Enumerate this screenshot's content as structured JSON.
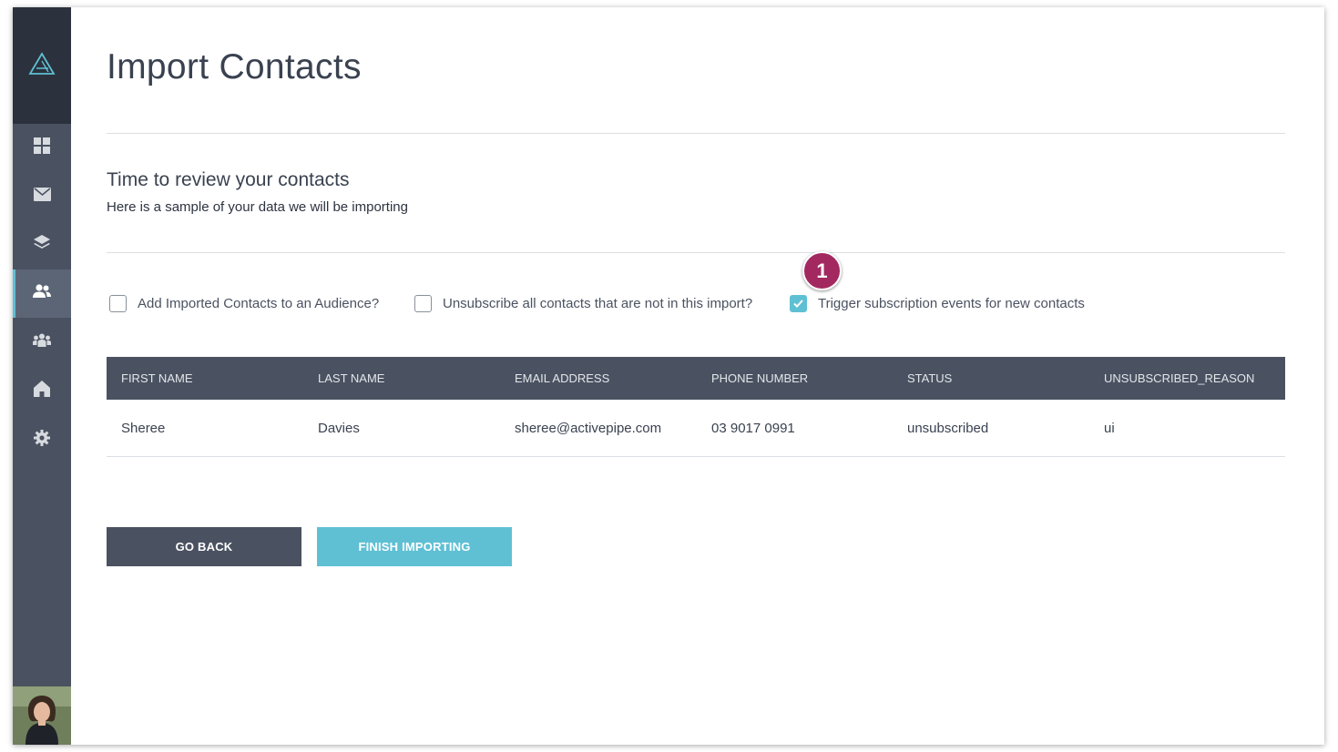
{
  "sidebar": {
    "logo_icon": "triangle-logo-icon",
    "items": [
      {
        "icon": "dashboard-grid-icon",
        "active": false
      },
      {
        "icon": "envelope-icon",
        "active": false
      },
      {
        "icon": "layers-icon",
        "active": false
      },
      {
        "icon": "contacts-icon",
        "active": true
      },
      {
        "icon": "audience-group-icon",
        "active": false
      },
      {
        "icon": "home-icon",
        "active": false
      },
      {
        "icon": "gear-icon",
        "active": false
      }
    ],
    "accent_color": "#5fc0d4"
  },
  "page": {
    "title": "Import Contacts",
    "section_title": "Time to review your contacts",
    "section_subtitle": "Here is a sample of your data we will be importing"
  },
  "options": [
    {
      "label": "Add Imported Contacts to an Audience?",
      "checked": false
    },
    {
      "label": "Unsubscribe all contacts that are not in this import?",
      "checked": false
    },
    {
      "label": "Trigger subscription events for new contacts",
      "checked": true
    }
  ],
  "badge": {
    "text": "1",
    "color": "#a3285f"
  },
  "table": {
    "headers": [
      "FIRST NAME",
      "LAST NAME",
      "EMAIL ADDRESS",
      "PHONE NUMBER",
      "STATUS",
      "UNSUBSCRIBED_REASON"
    ],
    "rows": [
      [
        "Sheree",
        "Davies",
        "sheree@activepipe.com",
        "03 9017 0991",
        "unsubscribed",
        "ui"
      ]
    ]
  },
  "buttons": {
    "back": "GO BACK",
    "finish": "FINISH IMPORTING"
  }
}
